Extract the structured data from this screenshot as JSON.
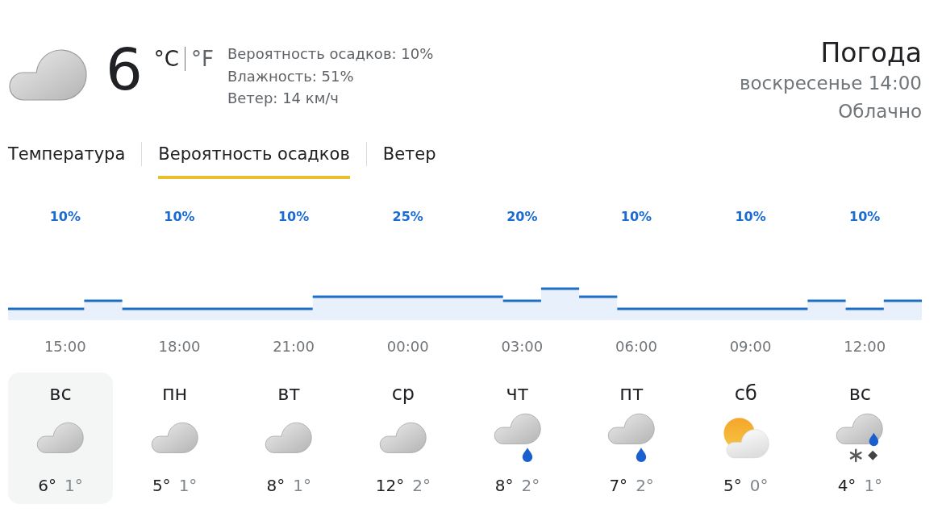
{
  "current": {
    "kind": "cloudy",
    "temperature": "6",
    "units": [
      {
        "label": "°C",
        "selected": true
      },
      {
        "label": "°F",
        "selected": false
      }
    ],
    "details": [
      "Вероятность осадков: 10%",
      "Влажность: 51%",
      "Ветер: 14 км/ч"
    ]
  },
  "summary": {
    "title": "Погода",
    "datetime": "воскресенье 14:00",
    "condition": "Облачно"
  },
  "tabs": [
    {
      "label": "Температура",
      "selected": false
    },
    {
      "label": "Вероятность осадков",
      "selected": true
    },
    {
      "label": "Ветер",
      "selected": false
    }
  ],
  "precipitation": {
    "hours": [
      {
        "chance": "10%",
        "time": "15:00"
      },
      {
        "chance": "10%",
        "time": "18:00"
      },
      {
        "chance": "10%",
        "time": "21:00"
      },
      {
        "chance": "25%",
        "time": "00:00"
      },
      {
        "chance": "20%",
        "time": "03:00"
      },
      {
        "chance": "10%",
        "time": "06:00"
      },
      {
        "chance": "10%",
        "time": "09:00"
      },
      {
        "chance": "10%",
        "time": "12:00"
      }
    ]
  },
  "days": [
    {
      "day": "вс",
      "kind": "cloudy",
      "high": "6°",
      "low": "1°",
      "selected": true
    },
    {
      "day": "пн",
      "kind": "cloudy",
      "high": "5°",
      "low": "1°",
      "selected": false
    },
    {
      "day": "вт",
      "kind": "cloudy",
      "high": "8°",
      "low": "1°",
      "selected": false
    },
    {
      "day": "ср",
      "kind": "cloudy",
      "high": "12°",
      "low": "2°",
      "selected": false
    },
    {
      "day": "чт",
      "kind": "rain",
      "high": "8°",
      "low": "2°",
      "selected": false
    },
    {
      "day": "пт",
      "kind": "rain",
      "high": "7°",
      "low": "2°",
      "selected": false
    },
    {
      "day": "сб",
      "kind": "partly-sunny",
      "high": "5°",
      "low": "0°",
      "selected": false
    },
    {
      "day": "вс",
      "kind": "rain-snow",
      "high": "4°",
      "low": "1°",
      "selected": false
    }
  ]
}
